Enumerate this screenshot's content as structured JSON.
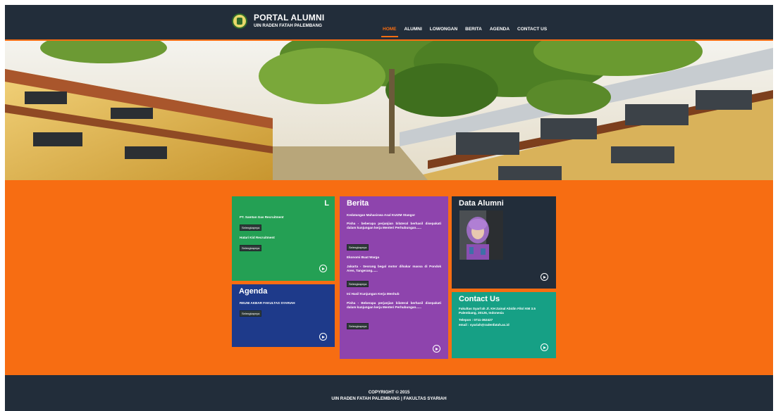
{
  "header": {
    "title": "PORTAL ALUMNI",
    "subtitle": "UIN RADEN FATAH PALEMBANG",
    "nav": [
      "HOME",
      "ALUMNI",
      "LOWONGAN",
      "BERITA",
      "AGENDA",
      "CONTACT US"
    ]
  },
  "lowongan": {
    "title": "L",
    "items": [
      {
        "title": "PT. Samtan Gas Recruitment",
        "more": "Selengkapnya"
      },
      {
        "title": "Hatari Kid Recruitment",
        "more": "Selengkapnya"
      }
    ]
  },
  "agenda": {
    "title": "Agenda",
    "item": "REUNI AKBAR FAKULTAS SYARIAH",
    "more": "Selengkapnya"
  },
  "berita": {
    "title": "Berita",
    "items": [
      {
        "title": "Kedatangan Mahasiswa Asal KUIZM Stangor",
        "text": "Pisha - beberapa perjanjian bilateral berhasil disepakati dalam kunjungan kerja Menteri Perhubungan......",
        "more": "Selengkapnya"
      },
      {
        "title": "Ekonomi Buat Warga",
        "text": "Jakarta - Seorang begal motor dihakar massa di Pondok Aren, Tangerang......",
        "more": "Selengkapnya"
      },
      {
        "title": "Ini Hasil Kunjungan Kerja Menhub",
        "text": "Pisha - Beberapa perjanjian bilateral berhasil disepakati dalam kunjungan kerja Menteri Perhubungan......",
        "more": "Selengkapnya"
      }
    ]
  },
  "alumni": {
    "title": "Data Alumni"
  },
  "contact": {
    "title": "Contact Us",
    "lines": [
      "Fakultas Syari'ah Jl. KH Zainal Abidin Fikri KM 3.5 Palembang, 30126, Indonesia",
      "Telepon : 0711-362427",
      "email : syariah@radenfatah.ac.id"
    ]
  },
  "footer": {
    "copyright": "COPYRIGHT © 2015",
    "line2": "UIN RADEN FATAH PALEMBANG | FAKULTAS SYARIAH"
  },
  "icons": [
    "logo-icon",
    "arrow-right-circle-icon"
  ],
  "colors": {
    "accent": "#f76d12",
    "dark": "#222d3a",
    "green": "#24a054",
    "blue": "#1e3a8a",
    "purple": "#8e44ad",
    "teal": "#16a085"
  }
}
